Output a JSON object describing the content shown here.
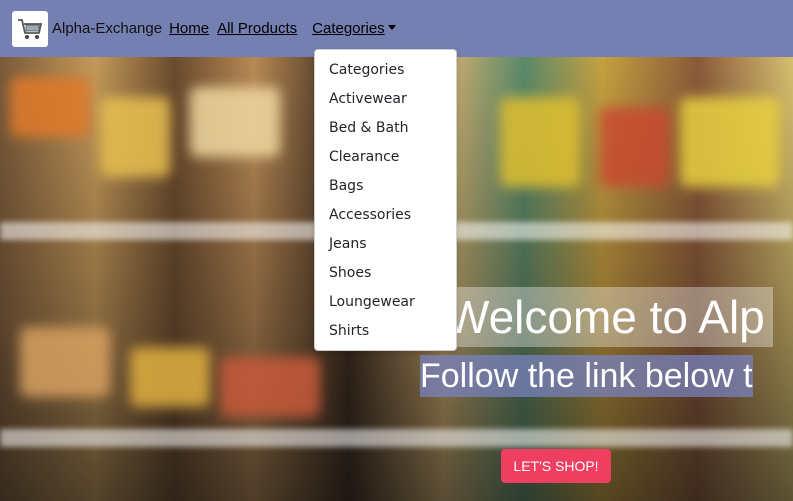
{
  "navbar": {
    "brand": "Alpha-Exchange",
    "logo_icon": "shopping-cart-icon",
    "links": {
      "home": "Home",
      "all_products": "All Products",
      "categories": "Categories"
    },
    "background": "#7480b1"
  },
  "dropdown": {
    "items": [
      "Categories",
      "Activewear",
      "Bed & Bath",
      "Clearance",
      "Bags",
      "Accessories",
      "Jeans",
      "Shoes",
      "Loungewear",
      "Shirts"
    ]
  },
  "hero": {
    "title": "Welcome to Alp",
    "subtitle": "Follow the link below t",
    "button_label": "LET'S SHOP!",
    "button_color": "#ee3f60"
  }
}
